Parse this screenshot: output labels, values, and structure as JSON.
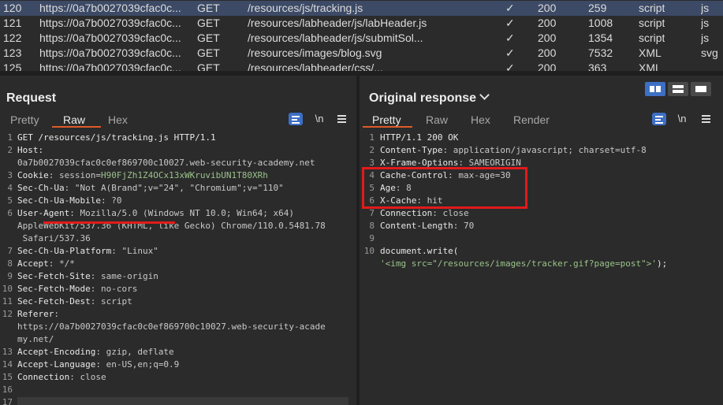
{
  "history": {
    "rows": [
      {
        "id": "120",
        "host": "https://0a7b0027039cfac0c...",
        "method": "GET",
        "url": "/resources/js/tracking.js",
        "edited": "✓",
        "status": "200",
        "length": "259",
        "mime": "script",
        "ext": "js"
      },
      {
        "id": "121",
        "host": "https://0a7b0027039cfac0c...",
        "method": "GET",
        "url": "/resources/labheader/js/labHeader.js",
        "edited": "✓",
        "status": "200",
        "length": "1008",
        "mime": "script",
        "ext": "js"
      },
      {
        "id": "122",
        "host": "https://0a7b0027039cfac0c...",
        "method": "GET",
        "url": "/resources/labheader/js/submitSol...",
        "edited": "✓",
        "status": "200",
        "length": "1354",
        "mime": "script",
        "ext": "js"
      },
      {
        "id": "123",
        "host": "https://0a7b0027039cfac0c...",
        "method": "GET",
        "url": "/resources/images/blog.svg",
        "edited": "✓",
        "status": "200",
        "length": "7532",
        "mime": "XML",
        "ext": "svg"
      },
      {
        "id": "125",
        "host": "https://0a7b0027039cfac0c...",
        "method": "GET",
        "url": "/resources/labheader/css/...",
        "edited": "✓",
        "status": "200",
        "length": "363",
        "mime": "XML",
        "ext": ""
      }
    ]
  },
  "request": {
    "title": "Request",
    "tabs": [
      "Pretty",
      "Raw",
      "Hex"
    ],
    "active_tab": "Raw",
    "newline_label": "\\n",
    "lines": [
      {
        "n": "1",
        "parts": [
          {
            "t": "GET /resources/js/tracking.js HTTP/1.1",
            "c": "k"
          }
        ]
      },
      {
        "n": "2",
        "parts": [
          {
            "t": "Host:",
            "c": "k"
          }
        ]
      },
      {
        "n": "",
        "parts": [
          {
            "t": "0a7b0027039cfac0c0ef869700c10027.web-security-academy.net",
            "c": "v"
          }
        ]
      },
      {
        "n": "3",
        "parts": [
          {
            "t": "Cookie",
            "c": "k"
          },
          {
            "t": ": session=",
            "c": "v"
          },
          {
            "t": "H90FjZh1Z4OCx13xWKruvibUN1T80XRh",
            "c": "g"
          }
        ]
      },
      {
        "n": "4",
        "parts": [
          {
            "t": "Sec-Ch-Ua",
            "c": "k"
          },
          {
            "t": ": \"Not A(Brand\";v=\"24\", \"Chromium\";v=\"110\"",
            "c": "v"
          }
        ]
      },
      {
        "n": "5",
        "parts": [
          {
            "t": "Sec-Ch-Ua-Mobile",
            "c": "k"
          },
          {
            "t": ": ?0",
            "c": "v"
          }
        ]
      },
      {
        "n": "6",
        "parts": [
          {
            "t": "User-Agent",
            "c": "k"
          },
          {
            "t": ": Mozilla/5.0 (Windows NT 10.0; Win64; x64)",
            "c": "v"
          }
        ]
      },
      {
        "n": "",
        "parts": [
          {
            "t": "AppleWebKit/537.36 (KHTML, like Gecko) Chrome/110.0.5481.78",
            "c": "v"
          }
        ]
      },
      {
        "n": "",
        "parts": [
          {
            "t": " Safari/537.36",
            "c": "v"
          }
        ]
      },
      {
        "n": "7",
        "parts": [
          {
            "t": "Sec-Ch-Ua-Platform",
            "c": "k"
          },
          {
            "t": ": \"Linux\"",
            "c": "v"
          }
        ]
      },
      {
        "n": "8",
        "parts": [
          {
            "t": "Accept",
            "c": "k"
          },
          {
            "t": ": */*",
            "c": "v"
          }
        ]
      },
      {
        "n": "9",
        "parts": [
          {
            "t": "Sec-Fetch-Site",
            "c": "k"
          },
          {
            "t": ": same-origin",
            "c": "v"
          }
        ]
      },
      {
        "n": "10",
        "parts": [
          {
            "t": "Sec-Fetch-Mode",
            "c": "k"
          },
          {
            "t": ": no-cors",
            "c": "v"
          }
        ]
      },
      {
        "n": "11",
        "parts": [
          {
            "t": "Sec-Fetch-Dest",
            "c": "k"
          },
          {
            "t": ": script",
            "c": "v"
          }
        ]
      },
      {
        "n": "12",
        "parts": [
          {
            "t": "Referer",
            "c": "k"
          },
          {
            "t": ":",
            "c": "v"
          }
        ]
      },
      {
        "n": "",
        "parts": [
          {
            "t": "https://0a7b0027039cfac0c0ef869700c10027.web-security-acade",
            "c": "v"
          }
        ]
      },
      {
        "n": "",
        "parts": [
          {
            "t": "my.net/",
            "c": "v"
          }
        ]
      },
      {
        "n": "13",
        "parts": [
          {
            "t": "Accept-Encoding",
            "c": "k"
          },
          {
            "t": ": gzip, deflate",
            "c": "v"
          }
        ]
      },
      {
        "n": "14",
        "parts": [
          {
            "t": "Accept-Language",
            "c": "k"
          },
          {
            "t": ": en-US,en;q=0.9",
            "c": "v"
          }
        ]
      },
      {
        "n": "15",
        "parts": [
          {
            "t": "Connection",
            "c": "k"
          },
          {
            "t": ": close",
            "c": "v"
          }
        ]
      },
      {
        "n": "16",
        "parts": []
      },
      {
        "n": "17",
        "parts": []
      }
    ]
  },
  "response": {
    "title": "Original response",
    "tabs": [
      "Pretty",
      "Raw",
      "Hex",
      "Render"
    ],
    "active_tab": "Pretty",
    "newline_label": "\\n",
    "lines": [
      {
        "n": "1",
        "parts": [
          {
            "t": "HTTP/1.1 200 OK",
            "c": "k"
          }
        ]
      },
      {
        "n": "2",
        "parts": [
          {
            "t": "Content-Type",
            "c": "k"
          },
          {
            "t": ": application/javascript; charset=utf-8",
            "c": "v"
          }
        ]
      },
      {
        "n": "3",
        "parts": [
          {
            "t": "X-Frame-Options",
            "c": "k"
          },
          {
            "t": ": SAMEORIGIN",
            "c": "v"
          }
        ]
      },
      {
        "n": "4",
        "parts": [
          {
            "t": "Cache-Control",
            "c": "k"
          },
          {
            "t": ": max-age=30",
            "c": "v"
          }
        ]
      },
      {
        "n": "5",
        "parts": [
          {
            "t": "Age",
            "c": "k"
          },
          {
            "t": ": 8",
            "c": "v"
          }
        ]
      },
      {
        "n": "6",
        "parts": [
          {
            "t": "X-Cache",
            "c": "k"
          },
          {
            "t": ": hit",
            "c": "v"
          }
        ]
      },
      {
        "n": "7",
        "parts": [
          {
            "t": "Connection",
            "c": "k"
          },
          {
            "t": ": close",
            "c": "v"
          }
        ]
      },
      {
        "n": "8",
        "parts": [
          {
            "t": "Content-Length",
            "c": "k"
          },
          {
            "t": ": 70",
            "c": "v"
          }
        ]
      },
      {
        "n": "9",
        "parts": []
      },
      {
        "n": "10",
        "parts": [
          {
            "t": "document.write(",
            "c": "k"
          }
        ]
      },
      {
        "n": "",
        "parts": [
          {
            "t": "'<img src=\"/resources/images/tracker.gif?page=post\">'",
            "c": "str"
          },
          {
            "t": ");",
            "c": "k"
          }
        ]
      }
    ]
  },
  "colors": {
    "accent": "#e05a28",
    "selection": "#3c4a66",
    "annotation": "#e01b1b",
    "button": "#3d6fc4"
  }
}
